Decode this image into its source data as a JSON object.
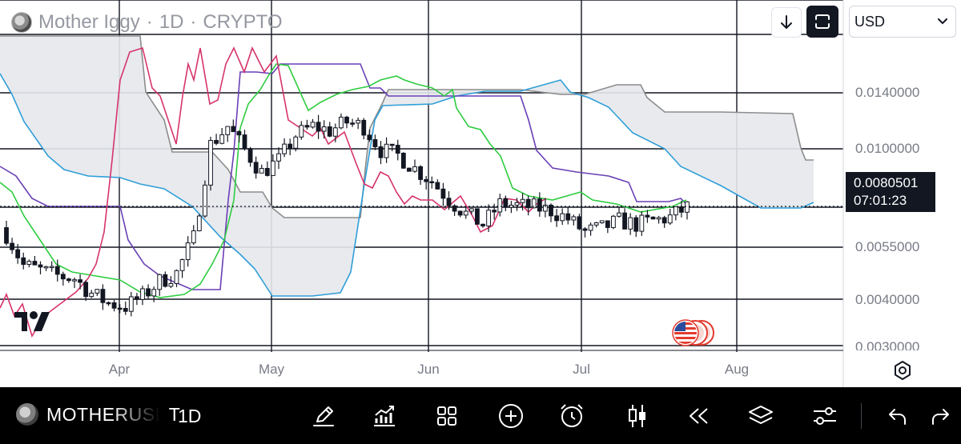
{
  "header": {
    "symbol_name": "Mother Iggy",
    "interval": "1D",
    "exchange": "CRYPTO",
    "separator": "·"
  },
  "toolbar": {
    "scroll_icon": "arrow-down-icon",
    "fit_icon": "fit-screen-icon",
    "currency": "USD",
    "currency_icon": "chevron-down-icon"
  },
  "price_axis": {
    "labels": [
      "0.0140000",
      "0.0100000",
      "0.0055000",
      "0.0040000",
      "0.0030000"
    ],
    "last_price": "0.0080501",
    "countdown": "07:01:23"
  },
  "time_axis": {
    "labels": [
      "Apr",
      "May",
      "Jun",
      "Jul",
      "Aug"
    ]
  },
  "bottom_bar": {
    "symbol": "MOTHERUSDT",
    "interval": "1D",
    "tools": [
      {
        "name": "draw-tool-button",
        "icon": "pen-icon"
      },
      {
        "name": "indicators-button",
        "icon": "indicators-icon"
      },
      {
        "name": "layouts-button",
        "icon": "grid-icon"
      },
      {
        "name": "add-button",
        "icon": "plus-circle-icon"
      },
      {
        "name": "alert-button",
        "icon": "alarm-clock-icon"
      },
      {
        "name": "chart-type-button",
        "icon": "candles-icon"
      },
      {
        "name": "replay-button",
        "icon": "rewind-icon"
      },
      {
        "name": "layers-button",
        "icon": "layers-icon"
      },
      {
        "name": "settings-sliders-button",
        "icon": "sliders-icon"
      },
      {
        "name": "undo-button",
        "icon": "undo-icon"
      },
      {
        "name": "redo-button",
        "icon": "redo-icon"
      }
    ]
  },
  "colors": {
    "candle": "#131722",
    "tenkan": "#2ecc40",
    "kijun": "#6a3fb5",
    "chikou": "#d6336c",
    "leading_b": "#8c8c8c",
    "leading_a": "#2f9ed8",
    "cloud_fill": "#e6e8ec"
  },
  "chart_data": {
    "type": "candlestick",
    "indicator": "Ichimoku Cloud",
    "x": [
      "Mar 24",
      "Mar 27",
      "Mar 30",
      "Apr 2",
      "Apr 5",
      "Apr 8",
      "Apr 11",
      "Apr 14",
      "Apr 17",
      "Apr 20",
      "Apr 23",
      "Apr 26",
      "Apr 29",
      "May 2",
      "May 5",
      "May 8",
      "May 11",
      "May 14",
      "May 17",
      "May 20",
      "May 23",
      "May 26",
      "May 29",
      "Jun 1",
      "Jun 4",
      "Jun 7",
      "Jun 10",
      "Jun 13",
      "Jun 16",
      "Jun 19",
      "Jun 22",
      "Jun 25",
      "Jun 28",
      "Jul 1",
      "Jul 4",
      "Jul 7",
      "Jul 10",
      "Jul 13",
      "Jul 16",
      "Jul 19",
      "Jul 22"
    ],
    "close": [
      0.0065,
      0.0051,
      0.0049,
      0.0047,
      0.0046,
      0.0041,
      0.0038,
      0.0037,
      0.004,
      0.0045,
      0.0048,
      0.0063,
      0.013,
      0.015,
      0.0125,
      0.0105,
      0.0115,
      0.014,
      0.015,
      0.0145,
      0.0155,
      0.015,
      0.0125,
      0.012,
      0.0108,
      0.0098,
      0.0085,
      0.0076,
      0.007,
      0.0082,
      0.0081,
      0.008,
      0.0078,
      0.0073,
      0.0066,
      0.0068,
      0.0072,
      0.007,
      0.0072,
      0.0074,
      0.008
    ],
    "ylim": [
      0.0028,
      0.019
    ],
    "y_scale": "log",
    "last_price": 0.0080501
  }
}
